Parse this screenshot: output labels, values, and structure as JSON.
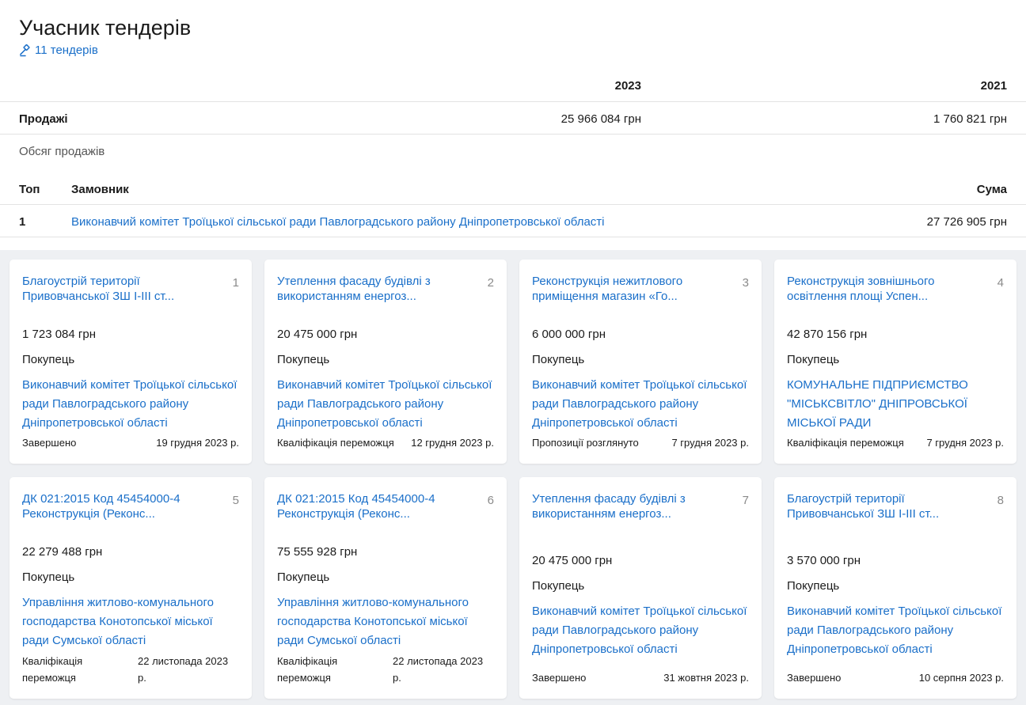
{
  "page": {
    "title": "Учасник тендерів",
    "tenders_link": "11 тендерів"
  },
  "sales": {
    "years": [
      "2023",
      "2021"
    ],
    "label": "Продажі",
    "values": [
      "25 966 084 грн",
      "1 760 821 грн"
    ]
  },
  "volume": {
    "label": "Обсяг продажів",
    "headers": {
      "top": "Топ",
      "customer": "Замовник",
      "sum": "Сума"
    },
    "rows": [
      {
        "top": "1",
        "customer": "Виконавчий комітет Троїцької сільської ради Павлоградського району Дніпропетровської області",
        "sum": "27 726 905 грн"
      }
    ]
  },
  "cards": [
    {
      "num": "1",
      "title": "Благоустрій території Привовчанської ЗШ І-ІІІ ст...",
      "amount": "1 723 084 грн",
      "buyer_label": "Покупець",
      "org": "Виконавчий комітет Троїцької сільської ради Павлоградського району Дніпропетровської області",
      "status": "Завершено",
      "date": "19 грудня 2023 р."
    },
    {
      "num": "2",
      "title": "Утеплення фасаду будівлі з використанням енергоз...",
      "amount": "20 475 000 грн",
      "buyer_label": "Покупець",
      "org": "Виконавчий комітет Троїцької сільської ради Павлоградського району Дніпропетровської області",
      "status": "Кваліфікація переможця",
      "date": "12 грудня 2023 р."
    },
    {
      "num": "3",
      "title": "Реконструкція нежитлового приміщення магазин «Го...",
      "amount": "6 000 000 грн",
      "buyer_label": "Покупець",
      "org": "Виконавчий комітет Троїцької сільської ради Павлоградського району Дніпропетровської області",
      "status": "Пропозиції розглянуто",
      "date": "7 грудня 2023 р."
    },
    {
      "num": "4",
      "title": "Реконструкція зовнішнього освітлення площі Успен...",
      "amount": "42 870 156 грн",
      "buyer_label": "Покупець",
      "org": "КОМУНАЛЬНЕ ПІДПРИЄМСТВО \"МІСЬКСВІТЛО\" ДНІПРОВСЬКОЇ МІСЬКОЇ РАДИ",
      "status": "Кваліфікація переможця",
      "date": "7 грудня 2023 р."
    },
    {
      "num": "5",
      "title": "ДК 021:2015 Код 45454000-4 Реконструкція (Реконс...",
      "amount": "22 279 488 грн",
      "buyer_label": "Покупець",
      "org": "Управління житлово-комунального господарства Конотопської міської ради Сумської області",
      "status": "Кваліфікація переможця",
      "date": "22 листопада 2023 р."
    },
    {
      "num": "6",
      "title": "ДК 021:2015 Код 45454000-4 Реконструкція (Реконс...",
      "amount": "75 555 928 грн",
      "buyer_label": "Покупець",
      "org": "Управління житлово-комунального господарства Конотопської міської ради Сумської області",
      "status": "Кваліфікація переможця",
      "date": "22 листопада 2023 р."
    },
    {
      "num": "7",
      "title": "Утеплення фасаду будівлі з використанням енергоз...",
      "amount": "20 475 000 грн",
      "buyer_label": "Покупець",
      "org": "Виконавчий комітет Троїцької сільської ради Павлоградського району Дніпропетровської області",
      "status": "Завершено",
      "date": "31 жовтня 2023 р."
    },
    {
      "num": "8",
      "title": "Благоустрій території Привовчанської ЗШ І-ІІІ ст...",
      "amount": "3 570 000 грн",
      "buyer_label": "Покупець",
      "org": "Виконавчий комітет Троїцької сільської ради Павлоградського району Дніпропетровської області",
      "status": "Завершено",
      "date": "10 серпня 2023 р."
    }
  ],
  "colors": {
    "link": "#1a6fc9",
    "grid_background": "#eef0f3",
    "divider": "#e3e3e3"
  }
}
